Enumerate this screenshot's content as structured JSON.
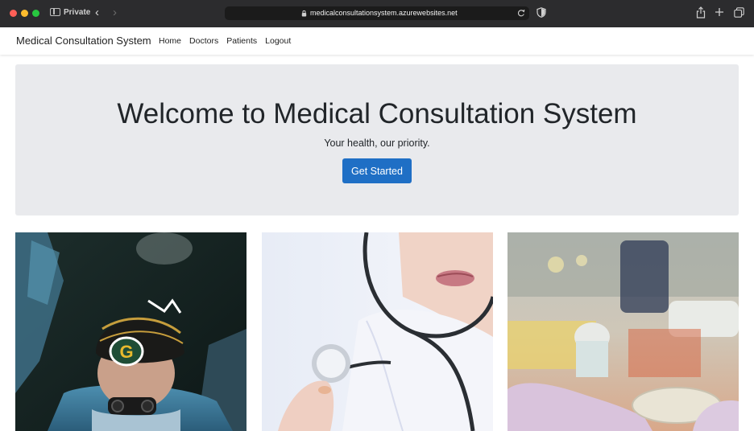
{
  "browser": {
    "mode_label": "Private",
    "url": "medicalconsultationsystem.azurewebsites.net"
  },
  "navbar": {
    "brand": "Medical Consultation System",
    "links": [
      "Home",
      "Doctors",
      "Patients",
      "Logout"
    ]
  },
  "hero": {
    "title": "Welcome to Medical Consultation System",
    "subtitle": "Your health, our priority.",
    "button_label": "Get Started"
  },
  "images": [
    {
      "subject": "surgeon-in-operating-room"
    },
    {
      "subject": "doctor-with-stethoscope"
    },
    {
      "subject": "gloved-hands-in-laboratory"
    }
  ],
  "colors": {
    "primary_button": "#1f6fc5",
    "jumbotron_bg": "#e9eaed",
    "chrome_bg": "#2c2c2e"
  }
}
